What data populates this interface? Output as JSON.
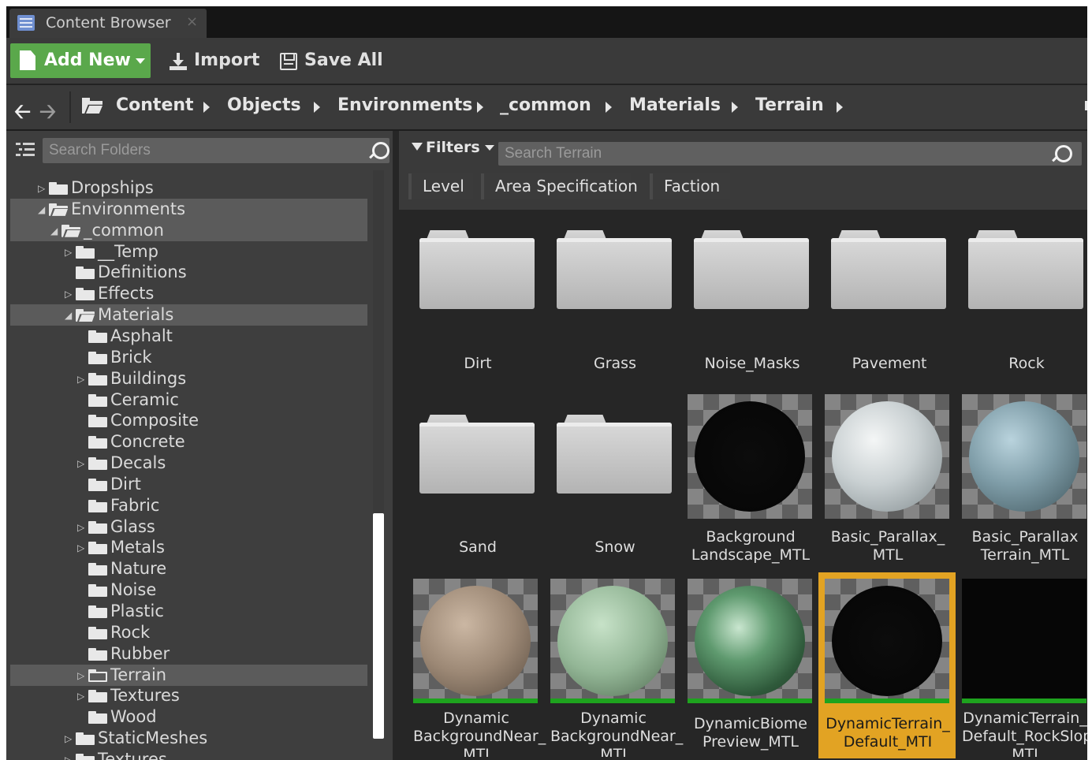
{
  "window": {
    "tab_title": "Content Browser",
    "tab_close": "×"
  },
  "toolbar": {
    "add_new": "Add New",
    "import": "Import",
    "save_all": "Save All"
  },
  "breadcrumb": [
    "Content",
    "Objects",
    "Environments",
    "_common",
    "Materials",
    "Terrain"
  ],
  "folders_panel": {
    "search_placeholder": "Search Folders",
    "tree": [
      {
        "label": "Dropships",
        "expander": "▷",
        "selected": false
      },
      {
        "label": "Environments",
        "expander": "◢",
        "selected": true
      },
      {
        "label": "_common",
        "expander": "◢",
        "selected": true
      },
      {
        "label": "__Temp",
        "expander": "▷",
        "selected": false
      },
      {
        "label": "Definitions",
        "expander": "",
        "selected": false
      },
      {
        "label": "Effects",
        "expander": "▷",
        "selected": false
      },
      {
        "label": "Materials",
        "expander": "◢",
        "selected": true
      },
      {
        "label": "Asphalt",
        "expander": "",
        "selected": false
      },
      {
        "label": "Brick",
        "expander": "",
        "selected": false
      },
      {
        "label": "Buildings",
        "expander": "▷",
        "selected": false
      },
      {
        "label": "Ceramic",
        "expander": "",
        "selected": false
      },
      {
        "label": "Composite",
        "expander": "",
        "selected": false
      },
      {
        "label": "Concrete",
        "expander": "",
        "selected": false
      },
      {
        "label": "Decals",
        "expander": "▷",
        "selected": false
      },
      {
        "label": "Dirt",
        "expander": "",
        "selected": false
      },
      {
        "label": "Fabric",
        "expander": "",
        "selected": false
      },
      {
        "label": "Glass",
        "expander": "▷",
        "selected": false
      },
      {
        "label": "Metals",
        "expander": "▷",
        "selected": false
      },
      {
        "label": "Nature",
        "expander": "",
        "selected": false
      },
      {
        "label": "Noise",
        "expander": "",
        "selected": false
      },
      {
        "label": "Plastic",
        "expander": "",
        "selected": false
      },
      {
        "label": "Rock",
        "expander": "",
        "selected": false
      },
      {
        "label": "Rubber",
        "expander": "",
        "selected": false
      },
      {
        "label": "Terrain",
        "expander": "▷",
        "selected": true
      },
      {
        "label": "Textures",
        "expander": "▷",
        "selected": false
      },
      {
        "label": "Wood",
        "expander": "",
        "selected": false
      },
      {
        "label": "StaticMeshes",
        "expander": "▷",
        "selected": false
      },
      {
        "label": "Textures",
        "expander": "▷",
        "selected": false
      }
    ]
  },
  "assets_panel": {
    "filters_label": "Filters",
    "search_placeholder": "Search Terrain",
    "filter_chips": [
      "Level",
      "Area Specification",
      "Faction"
    ],
    "folders": [
      "Dirt",
      "Grass",
      "Noise_Masks",
      "Pavement",
      "Rock",
      "Sand",
      "Snow"
    ],
    "materials": [
      {
        "name_line1": "Background",
        "name_line2": "Landscape_MTL",
        "selected": false
      },
      {
        "name_line1": "Basic_Parallax_",
        "name_line2": "MTL",
        "selected": false
      },
      {
        "name_line1": "Basic_Parallax",
        "name_line2": "Terrain_MTL",
        "selected": false
      },
      {
        "name_line1": "Dynamic",
        "name_line2": "BackgroundNear_",
        "name_line3": "MTI",
        "selected": false
      },
      {
        "name_line1": "Dynamic",
        "name_line2": "BackgroundNear_",
        "name_line3": "MTI",
        "selected": false
      },
      {
        "name_line1": "DynamicBiome",
        "name_line2": "Preview_MTL",
        "selected": false
      },
      {
        "name_line1": "DynamicTerrain_",
        "name_line2": "Default_MTI",
        "selected": true
      },
      {
        "name_line1": "DynamicTerrain_",
        "name_line2": "Default_RockSlope",
        "name_line3": "MTI",
        "selected": false
      }
    ]
  },
  "colors": {
    "accent_green": "#5aa84b",
    "selection_orange": "#e2a323",
    "panel_bg": "#3e3e3e",
    "asset_bg": "#262626"
  }
}
